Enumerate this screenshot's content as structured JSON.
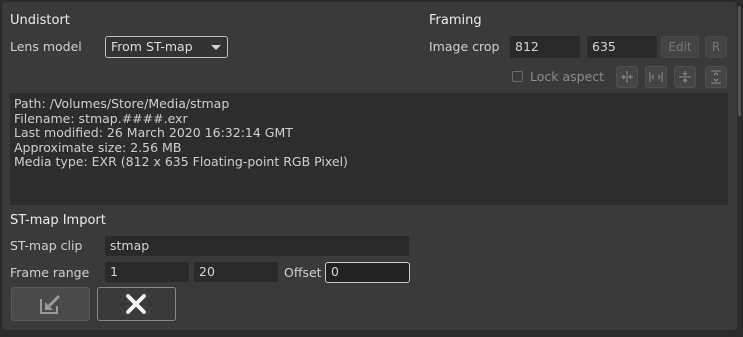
{
  "undistort": {
    "title": "Undistort",
    "lens_model_label": "Lens model",
    "lens_model_value": "From ST-map"
  },
  "framing": {
    "title": "Framing",
    "image_crop_label": "Image crop",
    "crop_width": "812",
    "crop_height": "635",
    "edit_label": "Edit",
    "reset_label": "R",
    "lock_aspect_label": "Lock aspect",
    "icons": [
      "fit-horizontal-icon",
      "expand-horizontal-icon",
      "fit-vertical-icon",
      "expand-vertical-icon"
    ]
  },
  "info": {
    "lines": [
      "Path: /Volumes/Store/Media/stmap",
      "Filename: stmap.####.exr",
      "Last modified: 26 March 2020 16:32:14 GMT",
      "Approximate size: 2.56 MB",
      "Media type: EXR (812 x 635 Floating-point RGB Pixel)"
    ]
  },
  "stmap_import": {
    "title": "ST-map Import",
    "clip_label": "ST-map clip",
    "clip_value": "stmap",
    "frame_range_label": "Frame range",
    "frame_start": "1",
    "frame_end": "20",
    "offset_label": "Offset",
    "offset_value": "0"
  },
  "actions": {
    "import_icon": "import-icon",
    "close_icon": "close-icon"
  },
  "colors": {
    "background": "#2b2b2b",
    "panel": "#3a3a3a",
    "field": "#2a2a2a",
    "text": "#cfcfcf"
  }
}
